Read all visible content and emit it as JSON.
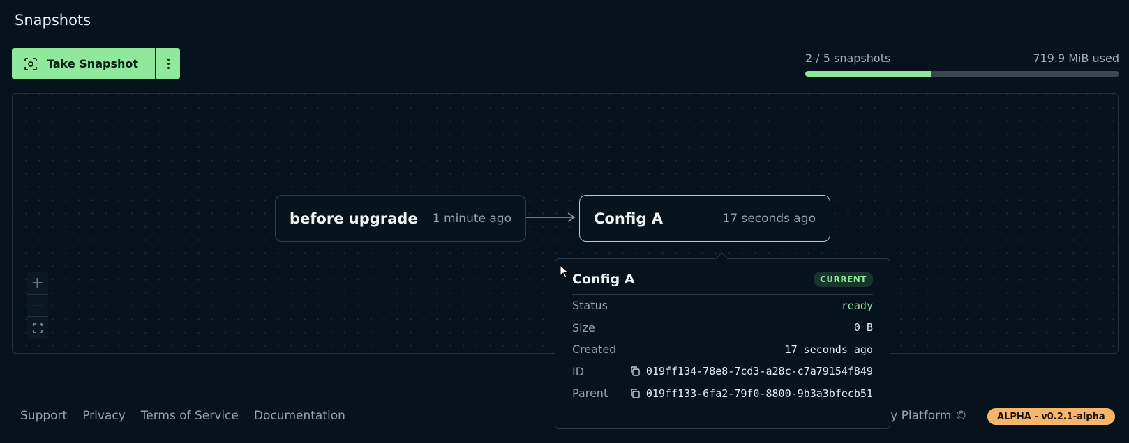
{
  "page": {
    "title": "Snapshots"
  },
  "toolbar": {
    "take_snapshot_label": "Take Snapshot",
    "snapshot_icon": "camera-focus-icon",
    "more_icon": "vertical-dots-icon"
  },
  "usage": {
    "count_label": "2 / 5 snapshots",
    "used_label": "719.9 MiB used",
    "fraction": 0.4
  },
  "graph": {
    "nodes": [
      {
        "name": "before upgrade",
        "time": "1 minute ago"
      },
      {
        "name": "Config A",
        "time": "17 seconds ago"
      }
    ],
    "zoom_in": "+",
    "zoom_out": "—"
  },
  "popover": {
    "title": "Config A",
    "badge": "CURRENT",
    "rows": [
      {
        "label": "Status",
        "value": "ready"
      },
      {
        "label": "Size",
        "value": "0 B"
      },
      {
        "label": "Created",
        "value": "17 seconds ago"
      },
      {
        "label": "ID",
        "value": "019ff134-78e8-7cd3-a28c-c7a79154f849"
      },
      {
        "label": "Parent",
        "value": "019ff133-6fa2-79f0-8800-9b3a3bfecb51"
      }
    ]
  },
  "footer": {
    "links": [
      "Support",
      "Privacy",
      "Terms of Service",
      "Documentation"
    ],
    "copyright": "ogy Platform ©",
    "version_badge": "ALPHA - v0.2.1-alpha"
  },
  "colors": {
    "accent": "#8fe89c",
    "background": "#06131c",
    "badge": "#f5b56a"
  }
}
